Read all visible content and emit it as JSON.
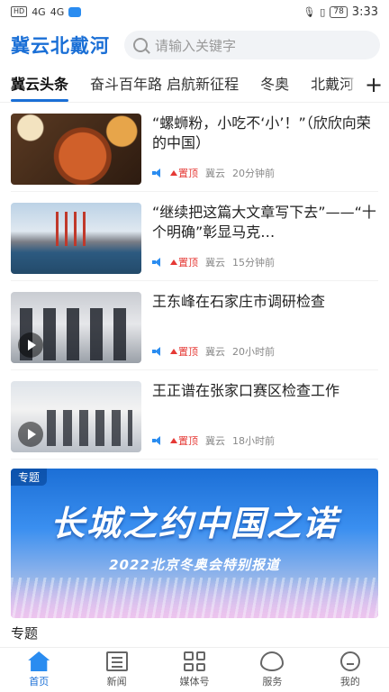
{
  "status": {
    "left_badges": [
      "HD",
      "4G",
      "4G"
    ],
    "battery": "78",
    "time": "3:33"
  },
  "header": {
    "logo": "冀云北戴河",
    "search_placeholder": "请输入关键字"
  },
  "tabs": [
    "冀云头条",
    "奋斗百年路 启航新征程",
    "冬奥",
    "北戴河"
  ],
  "news": [
    {
      "title": "“螺蛳粉，小吃不‘小’！”（欣欣向荣的中国）",
      "pin": "置顶",
      "source": "冀云",
      "time": "20分钟前",
      "video": false
    },
    {
      "title": "“继续把这篇大文章写下去”——“十个明确”彰显马克…",
      "pin": "置顶",
      "source": "冀云",
      "time": "15分钟前",
      "video": false
    },
    {
      "title": "王东峰在石家庄市调研检查",
      "pin": "置顶",
      "source": "冀云",
      "time": "20小时前",
      "video": true
    },
    {
      "title": "王正谱在张家口赛区检查工作",
      "pin": "置顶",
      "source": "冀云",
      "time": "18小时前",
      "video": true
    }
  ],
  "banner": {
    "tag": "专题",
    "headline": "长城之约中国之诺",
    "subline": "2022北京冬奥会特别报道"
  },
  "section_label": "专题",
  "tabbar": [
    {
      "label": "首页",
      "icon": "home-icon"
    },
    {
      "label": "新闻",
      "icon": "news-icon"
    },
    {
      "label": "媒体号",
      "icon": "media-icon"
    },
    {
      "label": "服务",
      "icon": "service-icon"
    },
    {
      "label": "我的",
      "icon": "profile-icon"
    }
  ],
  "colors": {
    "accent": "#1a6fd6",
    "pin": "#e53935"
  }
}
